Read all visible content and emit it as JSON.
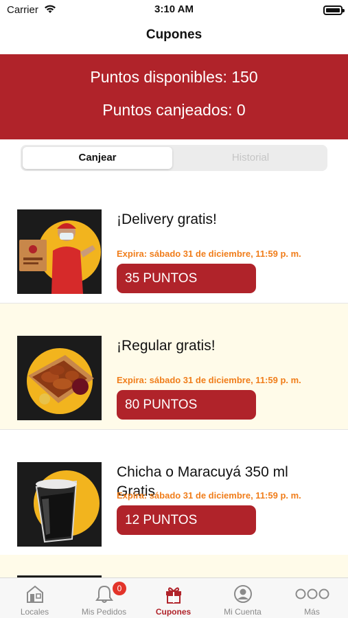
{
  "status_bar": {
    "carrier": "Carrier",
    "time": "3:10 AM"
  },
  "nav": {
    "title": "Cupones"
  },
  "points": {
    "available": "Puntos disponibles: 150",
    "redeemed": "Puntos canjeados: 0"
  },
  "segments": [
    {
      "label": "Canjear",
      "selected": true
    },
    {
      "label": "Historial",
      "selected": false
    }
  ],
  "coupons": [
    {
      "title": "¡Delivery gratis!",
      "expiry": "Expira: sábado 31 de diciembre, 11:59 p. m.",
      "points": "35 PUNTOS",
      "image": "delivery-person-icon"
    },
    {
      "title": "¡Regular gratis!",
      "expiry": "Expira: sábado 31 de diciembre, 11:59 p. m.",
      "points": "80 PUNTOS",
      "image": "chicken-wings-box-icon"
    },
    {
      "title": "Chicha o Maracuyá 350 ml Gratis",
      "expiry": "Expira: sábado 31 de diciembre, 11:59 p. m.",
      "points": "12 PUNTOS",
      "image": "drink-cup-icon"
    }
  ],
  "tab_bar": {
    "tabs": [
      {
        "label": "Locales",
        "icon": "store-icon"
      },
      {
        "label": "Mis Pedidos",
        "icon": "bell-icon",
        "badge": "0"
      },
      {
        "label": "Cupones",
        "icon": "gift-icon",
        "active": true
      },
      {
        "label": "Mi Cuenta",
        "icon": "user-icon"
      },
      {
        "label": "Más",
        "icon": "more-icon"
      }
    ]
  },
  "colors": {
    "brand_red": "#b0232a",
    "expiry_orange": "#f07d1a",
    "alt_row_bg": "#fffbe9",
    "badge_red": "#e3342a"
  }
}
